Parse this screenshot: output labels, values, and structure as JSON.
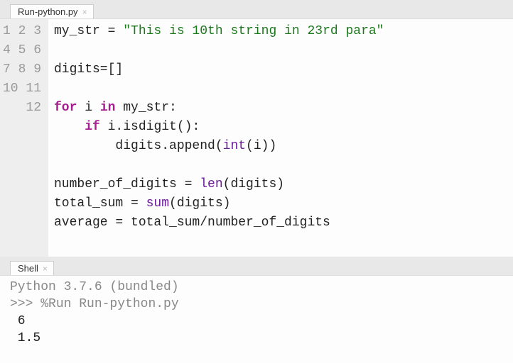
{
  "editor_tab": {
    "label": "Run-python.py"
  },
  "shell_tab": {
    "label": "Shell"
  },
  "code": {
    "lines": [
      "1",
      "2",
      "3",
      "4",
      "5",
      "6",
      "7",
      "8",
      "9",
      "10",
      "11",
      "12"
    ],
    "l1": {
      "a": "my_str = ",
      "b": "\"This is 10th string in 23rd para\""
    },
    "l3": "digits=[]",
    "l5": {
      "a": "for",
      "b": " i ",
      "c": "in",
      "d": " my_str:"
    },
    "l6": {
      "a": "    ",
      "b": "if",
      "c": " i.isdigit():"
    },
    "l7": {
      "a": "        digits.append(",
      "b": "int",
      "c": "(i))"
    },
    "l9": {
      "a": "number_of_digits = ",
      "b": "len",
      "c": "(digits)"
    },
    "l10": {
      "a": "total_sum = ",
      "b": "sum",
      "c": "(digits)"
    },
    "l11": "average = total_sum/number_of_digits"
  },
  "shell": {
    "banner": "Python 3.7.6 (bundled)",
    "prompt": ">>> ",
    "cmd": "%Run Run-python.py",
    "out1": " 6",
    "out2": " 1.5"
  }
}
